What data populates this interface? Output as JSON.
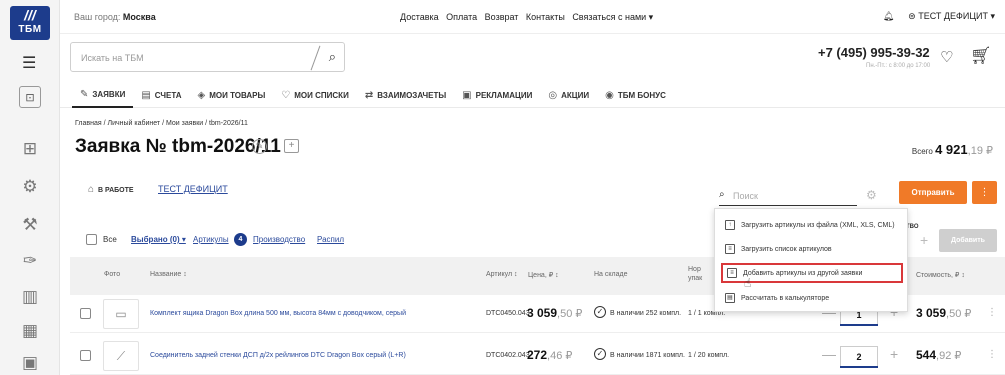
{
  "brand": {
    "mark": "///",
    "name": "ТБМ"
  },
  "topbar": {
    "city_label": "Ваш город:",
    "city": "Москва",
    "nav": [
      "Доставка",
      "Оплата",
      "Возврат",
      "Контакты",
      "Связаться с нами ▾"
    ],
    "account": "ТЕСТ ДЕФИЦИТ ▾"
  },
  "search": {
    "placeholder": "Искать на ТБМ"
  },
  "contact": {
    "phone": "+7 (495) 995-39-32",
    "hours": "Пн.-Пт.: с 8:00 до 17:00"
  },
  "tabs": [
    {
      "label": "ЗАЯВКИ",
      "icon": "✎"
    },
    {
      "label": "СЧЕТА",
      "icon": "▤"
    },
    {
      "label": "МОИ ТОВАРЫ",
      "icon": "◈"
    },
    {
      "label": "МОИ СПИСКИ",
      "icon": "♡"
    },
    {
      "label": "ВЗАИМОЗАЧЕТЫ",
      "icon": "⇄"
    },
    {
      "label": "РЕКЛАМАЦИИ",
      "icon": "▣"
    },
    {
      "label": "АКЦИИ",
      "icon": "◎"
    },
    {
      "label": "ТБМ БОНУС",
      "icon": "◉"
    }
  ],
  "breadcrumb": "Главная  /  Личный кабинет  /  Мои заявки  /  tbm-2026/11",
  "order": {
    "title": "Заявка № tbm-2026/11",
    "total_label": "Всего",
    "total_rub": "4 921",
    "total_kop": ",19 ₽",
    "status": "В РАБОТЕ",
    "client": "ТЕСТ ДЕФИЦИТ",
    "search_placeholder": "Поиск",
    "send_label": "Отправить",
    "more_label": "⋮"
  },
  "filters": {
    "all": "Все",
    "selected": "Выбрано (0) ▾",
    "articles": "Артикулы",
    "articles_count": "4",
    "production": "Производство",
    "cutting": "Распил"
  },
  "add_panel": {
    "qty_label": "ТВО",
    "add_label": "Добавить"
  },
  "table": {
    "headers": {
      "photo": "Фото",
      "name": "Название ↕",
      "article": "Артикул ↕",
      "price": "Цена, ₽ ↕",
      "stock": "На складе",
      "norm": "Нор\nупак",
      "cost": "Стоимость, ₽ ↕"
    },
    "rows": [
      {
        "name": "Комплект ящика Dragon Box длина 500 мм, высота 84мм с доводчиком, серый",
        "article": "DTC0450.043",
        "price_rub": "3 059",
        "price_kop": ",50 ₽",
        "stock": "В наличии 252 компл.",
        "norm": "1 / 1 компл.",
        "qty": "1",
        "cost_rub": "3 059",
        "cost_kop": ",50 ₽"
      },
      {
        "name": "Соединитель задней стенки ДСП д/2х рейлингов DTC Dragon Box серый (L+R)",
        "article": "DTC0402.043",
        "price_rub": "272",
        "price_kop": ",46 ₽",
        "stock": "В наличии 1871 компл.",
        "norm": "1 / 20 компл.",
        "qty": "2",
        "cost_rub": "544",
        "cost_kop": ",92 ₽"
      }
    ]
  },
  "menu": [
    "Загрузить артикулы из файла (XML, XLS, CML)",
    "Загрузить список артикулов",
    "Добавить артикулы из другой заявки",
    "Рассчитать в калькуляторе"
  ]
}
